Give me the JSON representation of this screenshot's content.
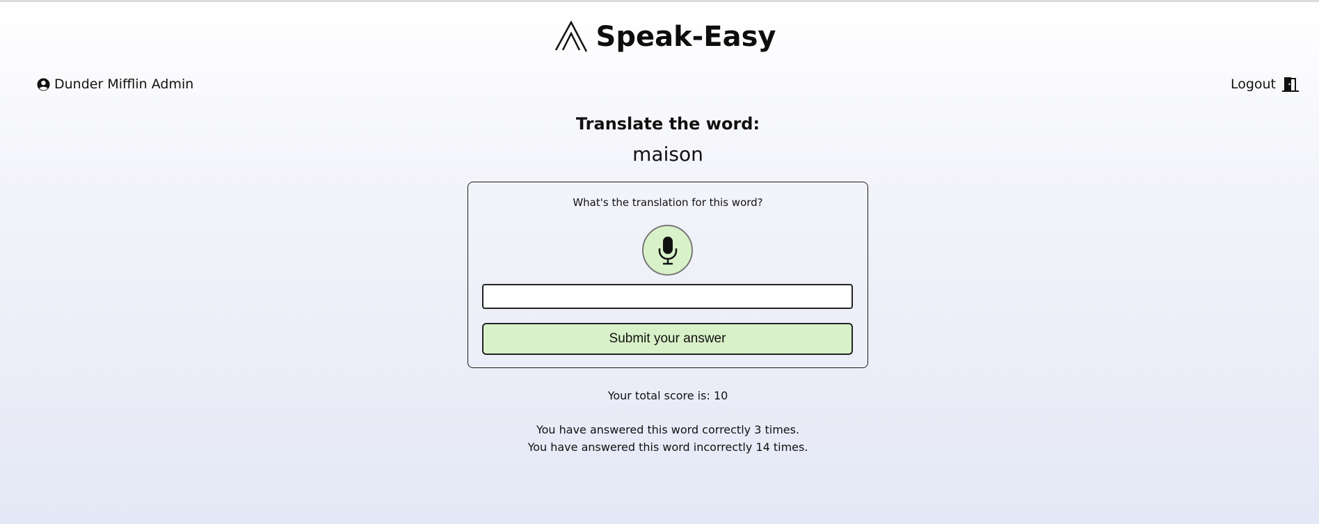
{
  "header": {
    "app_name": "Speak-Easy"
  },
  "user": {
    "name": "Dunder Mifflin Admin"
  },
  "nav": {
    "logout_label": "Logout"
  },
  "prompt": {
    "title": "Translate the word:",
    "word": "maison"
  },
  "card": {
    "question": "What's the translation for this word?",
    "input_value": "",
    "submit_label": "Submit your answer"
  },
  "score": {
    "text": "Your total score is: 10"
  },
  "stats": {
    "correct_text": "You have answered this word correctly 3 times.",
    "incorrect_text": "You have answered this word incorrectly 14 times."
  },
  "icons": {
    "logo": "mountain-peaks-icon",
    "user": "user-circle-icon",
    "logout": "door-exit-icon",
    "mic": "microphone-icon"
  },
  "colors": {
    "accent_green": "#d9f1c9",
    "text": "#111111"
  }
}
